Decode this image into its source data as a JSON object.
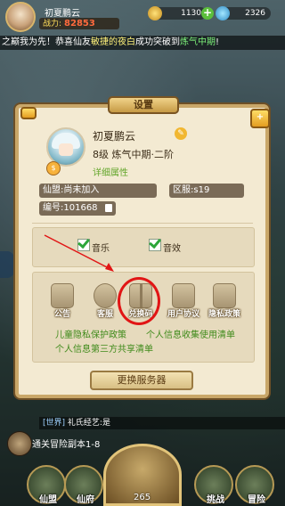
{
  "hud": {
    "player_name": "初夏鹏云",
    "power_label": "战力:",
    "power_value": "82853",
    "currency1": "1130",
    "currency1_plus": "+",
    "currency2": "2326"
  },
  "marquee": {
    "prefix": "之巅我为先！恭喜仙友",
    "name": "敏捷的夜白",
    "middle": "成功突破到",
    "stage": "炼气中期",
    "suffix": "!"
  },
  "dialog": {
    "title": "设置",
    "corner_badge": "+",
    "profile": {
      "name": "初夏鹏云",
      "level": "8级 炼气中期·二阶",
      "details_link": "详细属性",
      "guild": "仙盟:尚未加入",
      "server": "区服:s19",
      "id": "编号:101668"
    },
    "toggles": [
      {
        "label": "音乐",
        "checked": true
      },
      {
        "label": "音效",
        "checked": true
      }
    ],
    "buttons": [
      {
        "label": "公告",
        "icon": "announcement-icon"
      },
      {
        "label": "客服",
        "icon": "customer-service-icon"
      },
      {
        "label": "兑换码",
        "icon": "gift-icon"
      },
      {
        "label": "用户协议",
        "icon": "user-agreement-icon"
      },
      {
        "label": "隐私政策",
        "icon": "privacy-policy-icon"
      }
    ],
    "links": {
      "child_privacy": "儿童隐私保护政策",
      "info_collect": "个人信息收集使用清单",
      "third_party": "个人信息第三方共享清单"
    },
    "change_server": "更换服务器"
  },
  "chat": {
    "channel": "[世界]",
    "message": "礼氏经艺:是"
  },
  "quest": {
    "text": "通关冒险副本1-8",
    "avatar_label": "5"
  },
  "bottom_nav": [
    {
      "label": "仙盟"
    },
    {
      "label": "仙府"
    },
    {
      "label": "挑战"
    },
    {
      "label": "冒险"
    }
  ],
  "center_value": "265",
  "colors": {
    "highlight_red": "#e11515",
    "link_green": "#3f8a1a",
    "dialog_bg": "#f3ead2"
  }
}
